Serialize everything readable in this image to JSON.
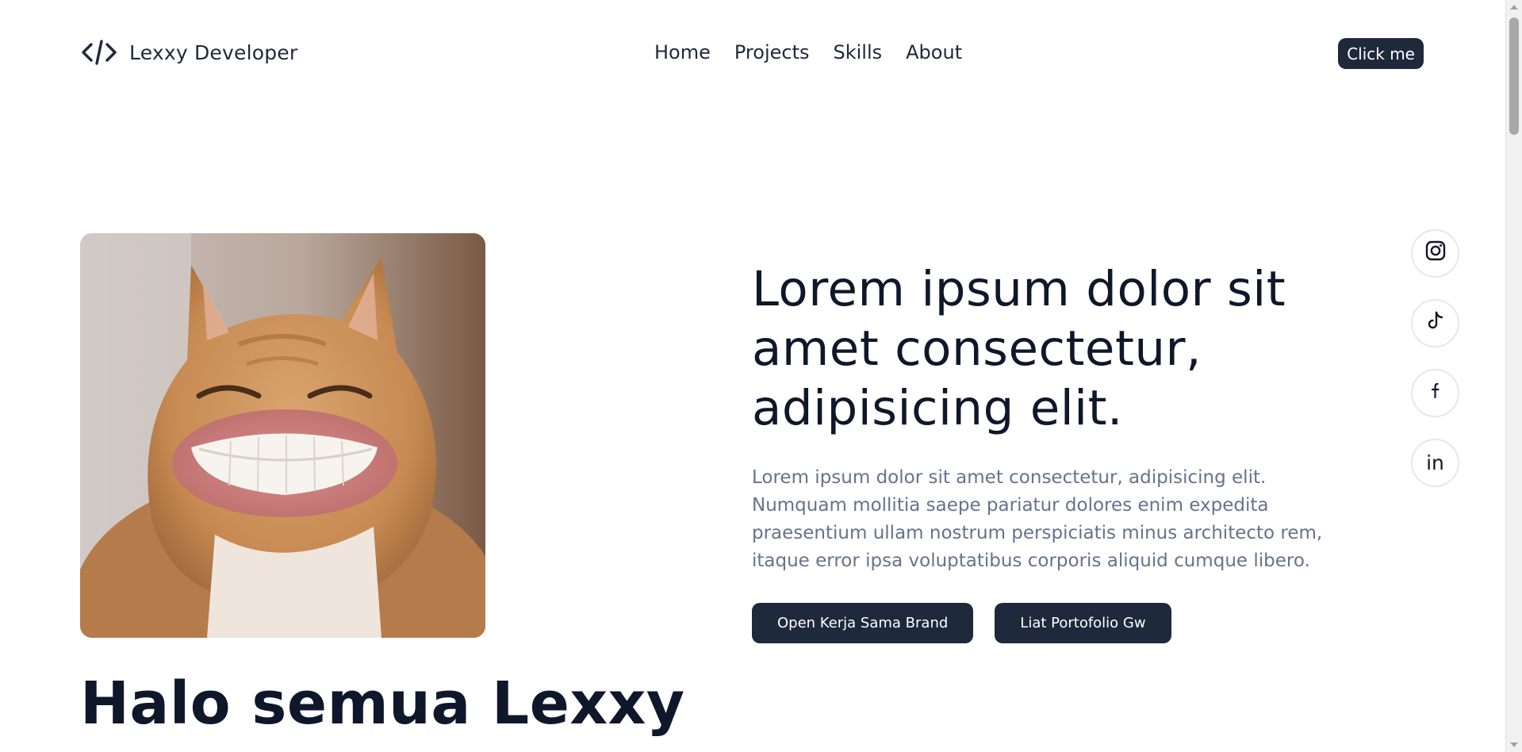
{
  "header": {
    "brand": "Lexxy Developer",
    "nav": [
      "Home",
      "Projects",
      "Skills",
      "About"
    ],
    "cta_label": "Click me"
  },
  "hero": {
    "photo_alt": "smiling cat",
    "title": "Lorem ipsum dolor sit amet consectetur, adipisicing elit.",
    "description": "Lorem ipsum dolor sit amet consectetur, adipisicing elit. Numquam mollitia saepe pariatur dolores enim expedita praesentium ullam nostrum perspiciatis minus architecto rem, itaque error ipsa voluptatibus corporis aliquid cumque libero.",
    "buttons": {
      "primary": "Open Kerja Sama Brand",
      "secondary": "Liat Portofolio Gw"
    }
  },
  "socials": {
    "items": [
      {
        "icon": "instagram-icon"
      },
      {
        "icon": "tiktok-icon"
      },
      {
        "icon": "facebook-icon"
      },
      {
        "icon": "linkedin-icon",
        "glyph": "in"
      }
    ]
  },
  "greeting": "Halo semua Lexxy",
  "colors": {
    "primary": "#1e293b",
    "text_muted": "#64748b",
    "heading": "#0f172a"
  }
}
